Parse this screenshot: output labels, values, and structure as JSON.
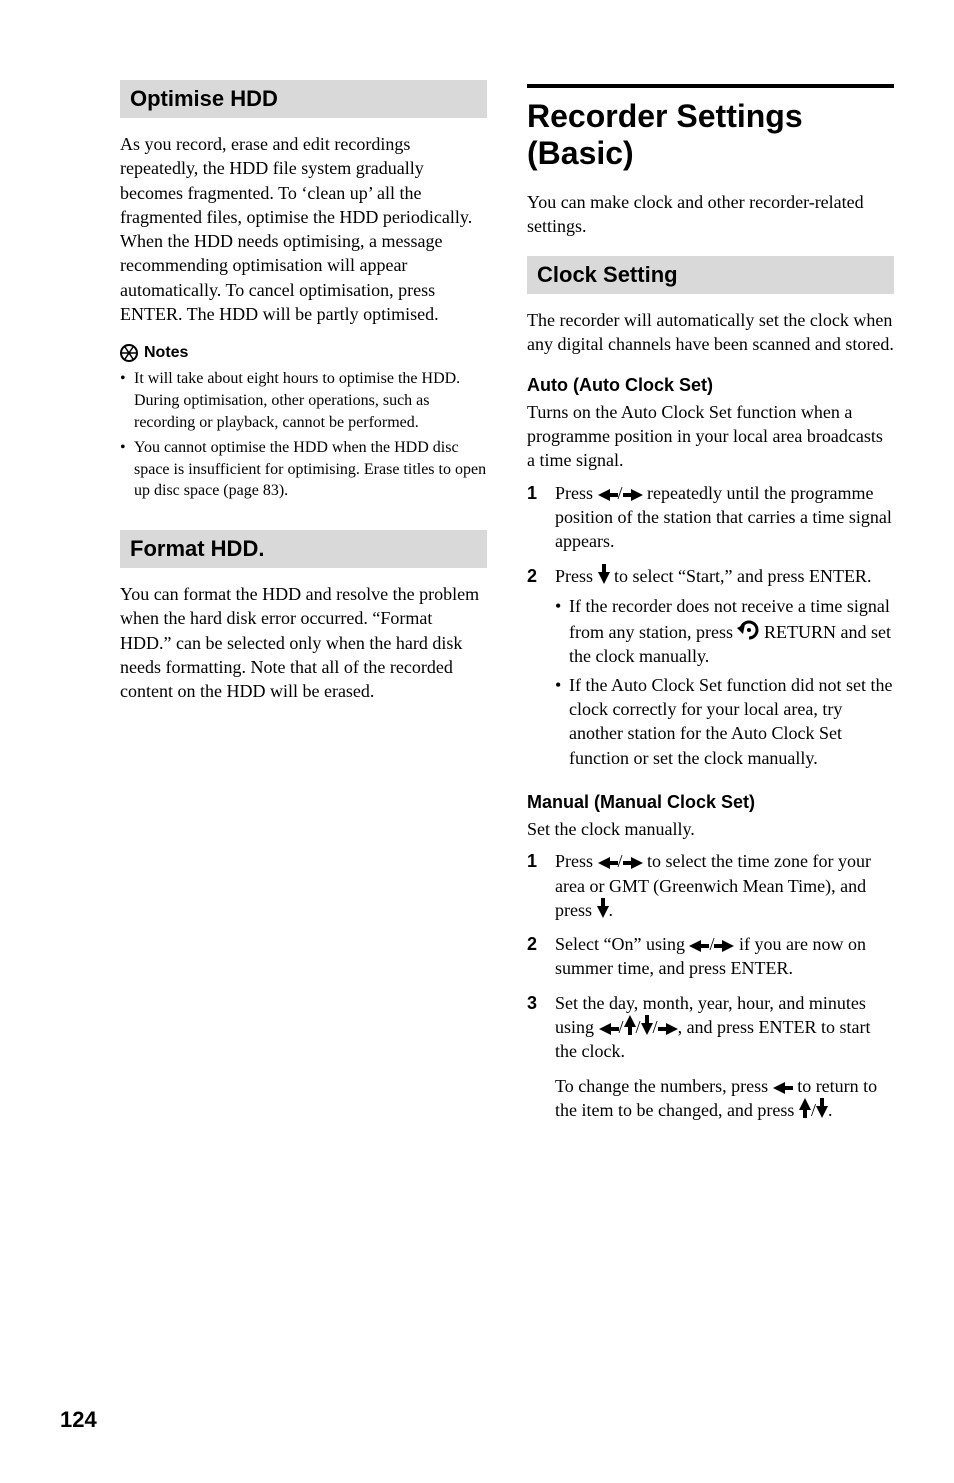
{
  "left": {
    "optimise": {
      "header": "Optimise HDD",
      "body": "As you record, erase and edit recordings repeatedly, the HDD file system gradually becomes fragmented. To ‘clean up’ all the fragmented files, optimise the HDD periodically. When the HDD needs optimising, a message recommending optimisation will appear automatically. To cancel optimisation, press ENTER. The HDD will be partly optimised.",
      "notes_label": "Notes",
      "notes": [
        "It will take about eight hours to optimise the HDD. During optimisation, other operations, such as recording or playback, cannot be performed.",
        "You cannot optimise the HDD when the HDD disc space is insufficient for optimising. Erase titles to open up disc space (page 83)."
      ]
    },
    "format": {
      "header": "Format HDD.",
      "body": "You can format the HDD and resolve the problem when the hard disk error occurred. “Format HDD.” can be selected only when the hard disk needs formatting. Note that all of the recorded content on the HDD will be erased."
    }
  },
  "right": {
    "title": "Recorder Settings (Basic)",
    "intro": "You can make clock and other recorder-related settings.",
    "clock": {
      "header": "Clock Setting",
      "intro": "The recorder will automatically set the clock when any digital channels have been scanned and stored.",
      "auto": {
        "heading": "Auto (Auto Clock Set)",
        "body": "Turns on the Auto Clock Set function when a programme position in your local area broadcasts a time signal.",
        "steps": {
          "s1_a": "Press ",
          "s1_b": " repeatedly until the programme position of the station that carries a time signal appears.",
          "s2_a": "Press ",
          "s2_b": " to select “Start,” and press ENTER.",
          "s2_bullets": {
            "b1_a": "If the recorder does not receive a time signal from any station, press ",
            "b1_b": " RETURN and set the clock manually.",
            "b2": "If the Auto Clock Set function did not set the clock correctly for your local area, try another station for the Auto Clock Set function or set the clock manually."
          }
        }
      },
      "manual": {
        "heading": "Manual (Manual Clock Set)",
        "body": "Set the clock manually.",
        "steps": {
          "s1_a": "Press ",
          "s1_b": " to select the time zone for your area or GMT (Greenwich Mean Time), and press ",
          "s1_c": ".",
          "s2_a": "Select “On” using ",
          "s2_b": " if you are now on summer time, and press ENTER.",
          "s3_a": "Set the day, month, year, hour, and minutes using ",
          "s3_b": ", and press ENTER to start the clock.",
          "after_a": "To change the numbers, press ",
          "after_b": " to return to the item to be changed, and press ",
          "after_c": "."
        }
      }
    }
  },
  "page_number": "124"
}
